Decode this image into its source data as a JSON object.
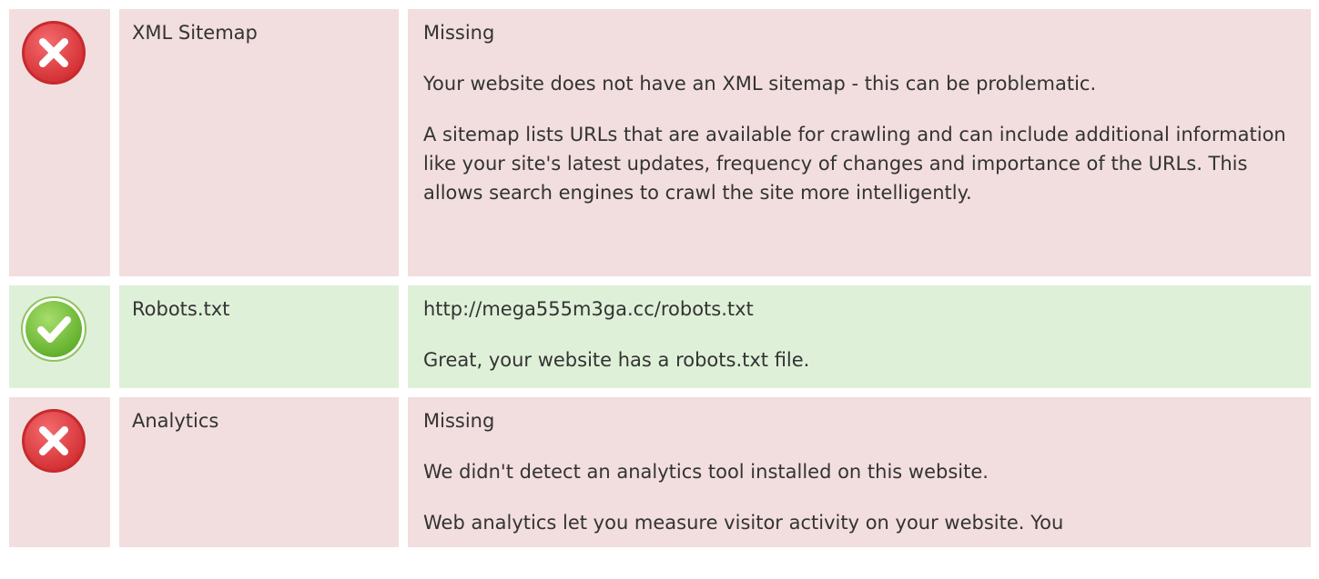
{
  "rows": [
    {
      "status": "error",
      "icon": "error-x-icon",
      "name": "XML Sitemap",
      "value": "Missing",
      "paragraphs": [
        "Your website does not have an XML sitemap - this can be problematic.",
        "A sitemap lists URLs that are available for crawling and can include additional information like your site's latest updates, frequency of changes and importance of the URLs. This allows search engines to crawl the site more intelligently."
      ]
    },
    {
      "status": "success",
      "icon": "success-check-icon",
      "name": "Robots.txt",
      "value": "http://mega555m3ga.cc/robots.txt",
      "paragraphs": [
        "Great, your website has a robots.txt file."
      ]
    },
    {
      "status": "error",
      "icon": "error-x-icon",
      "name": "Analytics",
      "value": "Missing",
      "paragraphs": [
        "We didn't detect an analytics tool installed on this website.",
        "Web analytics let you measure visitor activity on your website. You"
      ]
    }
  ],
  "colors": {
    "error_bg": "#f2dede",
    "success_bg": "#dff0d8",
    "error_icon": "#e8464a",
    "success_icon": "#7cc63f",
    "text": "#333333"
  }
}
